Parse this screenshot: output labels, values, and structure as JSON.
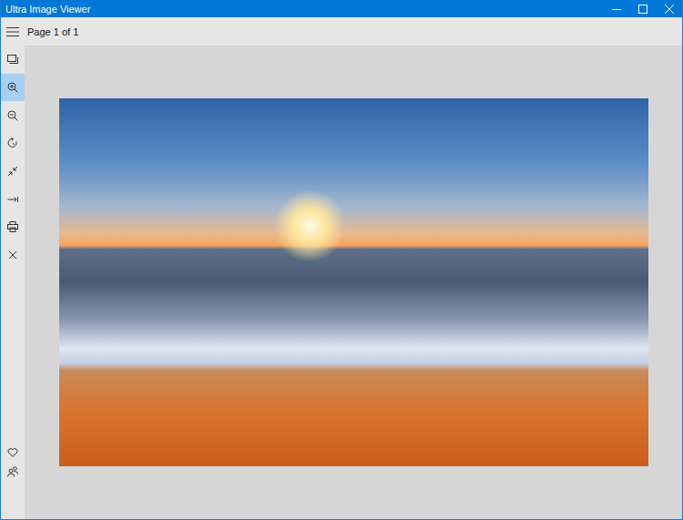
{
  "window": {
    "title": "Ultra Image Viewer"
  },
  "toolbar": {
    "page_label": "Page 1 of 1"
  },
  "sidebar": {
    "items": [
      {
        "selected": false
      },
      {
        "selected": true
      },
      {
        "selected": false
      },
      {
        "selected": false
      },
      {
        "selected": false
      },
      {
        "selected": false
      },
      {
        "selected": false
      },
      {
        "selected": false
      }
    ],
    "bottom_items": [
      {
        "selected": false
      },
      {
        "selected": false
      }
    ]
  }
}
